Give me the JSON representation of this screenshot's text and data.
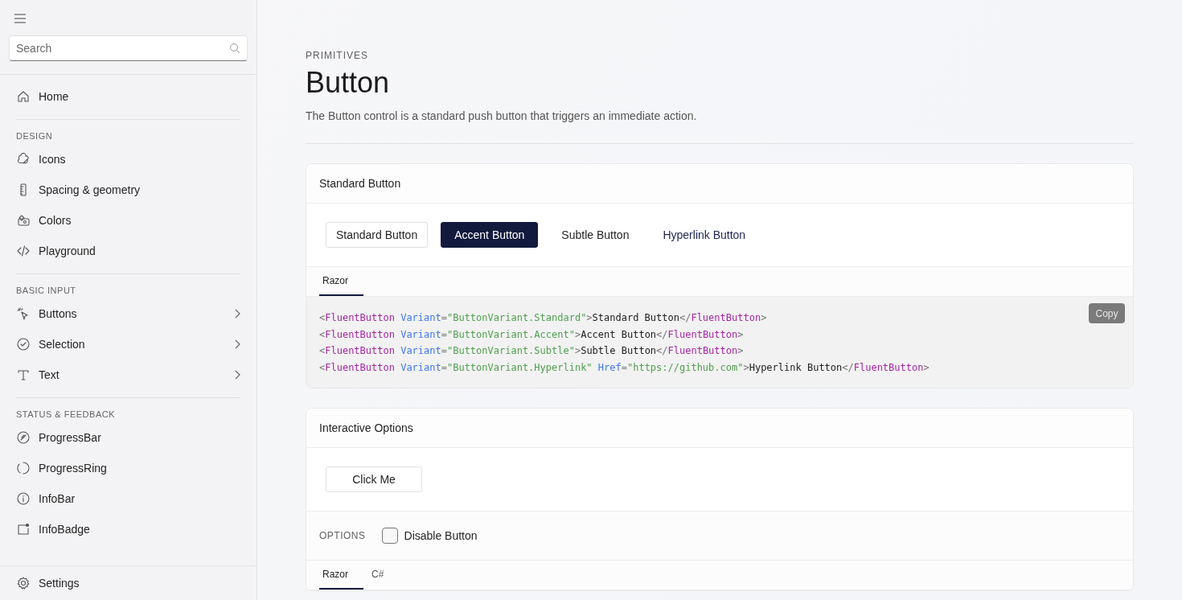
{
  "sidebar": {
    "search": {
      "placeholder": "Search"
    },
    "home": {
      "label": "Home"
    },
    "sections": [
      {
        "title": "DESIGN",
        "items": [
          {
            "label": "Icons",
            "chevron": false
          },
          {
            "label": "Spacing & geometry",
            "chevron": false
          },
          {
            "label": "Colors",
            "chevron": false
          },
          {
            "label": "Playground",
            "chevron": false
          }
        ]
      },
      {
        "title": "BASIC INPUT",
        "items": [
          {
            "label": "Buttons",
            "chevron": true
          },
          {
            "label": "Selection",
            "chevron": true
          },
          {
            "label": "Text",
            "chevron": true
          }
        ]
      },
      {
        "title": "STATUS & FEEDBACK",
        "items": [
          {
            "label": "ProgressBar",
            "chevron": false
          },
          {
            "label": "ProgressRing",
            "chevron": false
          },
          {
            "label": "InfoBar",
            "chevron": false
          },
          {
            "label": "InfoBadge",
            "chevron": false
          }
        ]
      }
    ],
    "settings": {
      "label": "Settings"
    }
  },
  "page": {
    "eyebrow": "PRIMITIVES",
    "title": "Button",
    "description": "The Button control is a standard push button that triggers an immediate action."
  },
  "cards": [
    {
      "title": "Standard Button",
      "buttons": [
        {
          "label": "Standard Button",
          "kind": "standard"
        },
        {
          "label": "Accent Button",
          "kind": "accent"
        },
        {
          "label": "Subtle Button",
          "kind": "subtle"
        },
        {
          "label": "Hyperlink Button",
          "kind": "hyperlink"
        }
      ],
      "tabs": [
        {
          "label": "Razor",
          "selected": true
        }
      ],
      "code": {
        "copy": "Copy",
        "lines": [
          [
            {
              "kind": "punct",
              "text": "<"
            },
            {
              "kind": "tag",
              "text": "FluentButton"
            },
            {
              "kind": "attr",
              "text": "Variant"
            },
            {
              "kind": "punct",
              "text": "="
            },
            {
              "kind": "str",
              "text": "\"ButtonVariant.Standard\""
            },
            {
              "kind": "punct",
              "text": ">"
            },
            {
              "kind": "text",
              "text": "Standard Button"
            },
            {
              "kind": "punct",
              "text": "</"
            },
            {
              "kind": "tag",
              "text": "FluentButton"
            },
            {
              "kind": "punct",
              "text": ">"
            }
          ],
          [
            {
              "kind": "punct",
              "text": "<"
            },
            {
              "kind": "tag",
              "text": "FluentButton"
            },
            {
              "kind": "attr",
              "text": "Variant"
            },
            {
              "kind": "punct",
              "text": "="
            },
            {
              "kind": "str",
              "text": "\"ButtonVariant.Accent\""
            },
            {
              "kind": "punct",
              "text": ">"
            },
            {
              "kind": "text",
              "text": "Accent Button"
            },
            {
              "kind": "punct",
              "text": "</"
            },
            {
              "kind": "tag",
              "text": "FluentButton"
            },
            {
              "kind": "punct",
              "text": ">"
            }
          ],
          [
            {
              "kind": "punct",
              "text": "<"
            },
            {
              "kind": "tag",
              "text": "FluentButton"
            },
            {
              "kind": "attr",
              "text": "Variant"
            },
            {
              "kind": "punct",
              "text": "="
            },
            {
              "kind": "str",
              "text": "\"ButtonVariant.Subtle\""
            },
            {
              "kind": "punct",
              "text": ">"
            },
            {
              "kind": "text",
              "text": "Subtle Button"
            },
            {
              "kind": "punct",
              "text": "</"
            },
            {
              "kind": "tag",
              "text": "FluentButton"
            },
            {
              "kind": "punct",
              "text": ">"
            }
          ],
          [
            {
              "kind": "punct",
              "text": "<"
            },
            {
              "kind": "tag",
              "text": "FluentButton"
            },
            {
              "kind": "attr",
              "text": "Variant"
            },
            {
              "kind": "punct",
              "text": "="
            },
            {
              "kind": "str",
              "text": "\"ButtonVariant.Hyperlink\""
            },
            {
              "kind": "attr",
              "text": "Href"
            },
            {
              "kind": "punct",
              "text": "="
            },
            {
              "kind": "str",
              "text": "\"https://github.com\""
            },
            {
              "kind": "punct",
              "text": ">"
            },
            {
              "kind": "text",
              "text": "Hyperlink Button"
            },
            {
              "kind": "punct",
              "text": "</"
            },
            {
              "kind": "tag",
              "text": "FluentButton"
            },
            {
              "kind": "punct",
              "text": ">"
            }
          ]
        ]
      }
    },
    {
      "title": "Interactive Options",
      "buttons": [
        {
          "label": "Click Me",
          "kind": "standard"
        }
      ],
      "options": {
        "label": "OPTIONS",
        "checkbox": {
          "label": "Disable Button",
          "checked": false
        }
      },
      "tabs": [
        {
          "label": "Razor",
          "selected": true
        },
        {
          "label": "C#",
          "selected": false
        }
      ]
    }
  ]
}
